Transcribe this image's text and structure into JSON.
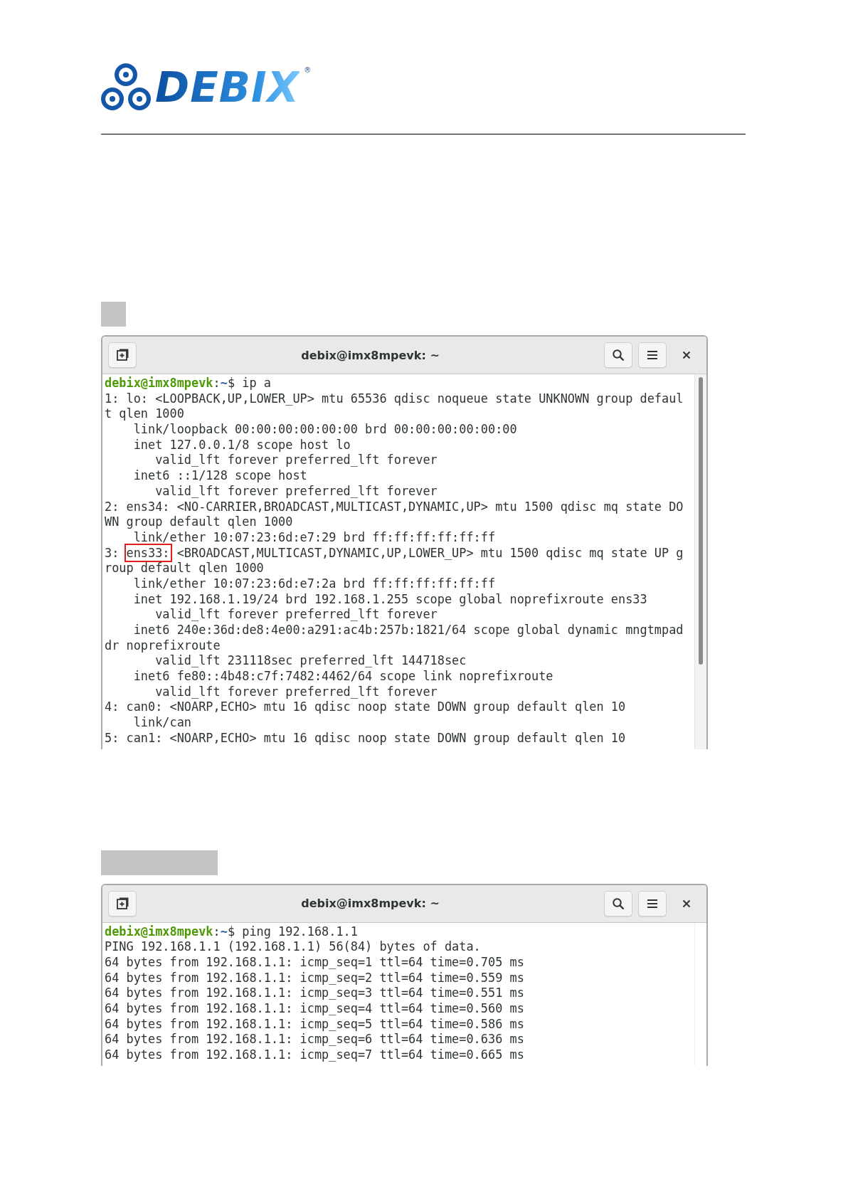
{
  "logo": {
    "text": "DEBIX",
    "mark": "®"
  },
  "sections": [
    {
      "label": {
        "kind": "square"
      },
      "terminal": {
        "title": "debix@imx8mpevk: ~",
        "scrollbar": true,
        "lines": [
          {
            "kind": "prompt",
            "user": "debix@imx8mpevk",
            "sep": ":",
            "path": "~",
            "command": "$ ip a"
          },
          {
            "kind": "plain",
            "text": "1: lo: <LOOPBACK,UP,LOWER_UP> mtu 65536 qdisc noqueue state UNKNOWN group defaul"
          },
          {
            "kind": "plain",
            "text": "t qlen 1000"
          },
          {
            "kind": "plain",
            "text": "    link/loopback 00:00:00:00:00:00 brd 00:00:00:00:00:00"
          },
          {
            "kind": "plain",
            "text": "    inet 127.0.0.1/8 scope host lo"
          },
          {
            "kind": "plain",
            "text": "       valid_lft forever preferred_lft forever"
          },
          {
            "kind": "plain",
            "text": "    inet6 ::1/128 scope host"
          },
          {
            "kind": "plain",
            "text": "       valid_lft forever preferred_lft forever"
          },
          {
            "kind": "plain",
            "text": "2: ens34: <NO-CARRIER,BROADCAST,MULTICAST,DYNAMIC,UP> mtu 1500 qdisc mq state DO"
          },
          {
            "kind": "plain",
            "text": "WN group default qlen 1000"
          },
          {
            "kind": "plain",
            "text": "    link/ether 10:07:23:6d:e7:29 brd ff:ff:ff:ff:ff:ff"
          },
          {
            "kind": "marked",
            "before": "3: ",
            "marked": "ens33:",
            "after": " <BROADCAST,MULTICAST,DYNAMIC,UP,LOWER_UP> mtu 1500 qdisc mq state UP g"
          },
          {
            "kind": "plain",
            "text": "roup default qlen 1000"
          },
          {
            "kind": "plain",
            "text": "    link/ether 10:07:23:6d:e7:2a brd ff:ff:ff:ff:ff:ff"
          },
          {
            "kind": "plain",
            "text": "    inet 192.168.1.19/24 brd 192.168.1.255 scope global noprefixroute ens33"
          },
          {
            "kind": "plain",
            "text": "       valid_lft forever preferred_lft forever"
          },
          {
            "kind": "plain",
            "text": "    inet6 240e:36d:de8:4e00:a291:ac4b:257b:1821/64 scope global dynamic mngtmpad"
          },
          {
            "kind": "plain",
            "text": "dr noprefixroute"
          },
          {
            "kind": "plain",
            "text": "       valid_lft 231118sec preferred_lft 144718sec"
          },
          {
            "kind": "plain",
            "text": "    inet6 fe80::4b48:c7f:7482:4462/64 scope link noprefixroute"
          },
          {
            "kind": "plain",
            "text": "       valid_lft forever preferred_lft forever"
          },
          {
            "kind": "plain",
            "text": "4: can0: <NOARP,ECHO> mtu 16 qdisc noop state DOWN group default qlen 10"
          },
          {
            "kind": "plain",
            "text": "    link/can"
          },
          {
            "kind": "plain",
            "text": "5: can1: <NOARP,ECHO> mtu 16 qdisc noop state DOWN group default qlen 10"
          }
        ]
      }
    },
    {
      "label": {
        "kind": "bar"
      },
      "terminal": {
        "title": "debix@imx8mpevk: ~",
        "scrollbar": false,
        "lines": [
          {
            "kind": "prompt",
            "user": "debix@imx8mpevk",
            "sep": ":",
            "path": "~",
            "command": "$ ping 192.168.1.1"
          },
          {
            "kind": "plain",
            "text": "PING 192.168.1.1 (192.168.1.1) 56(84) bytes of data."
          },
          {
            "kind": "plain",
            "text": "64 bytes from 192.168.1.1: icmp_seq=1 ttl=64 time=0.705 ms"
          },
          {
            "kind": "plain",
            "text": "64 bytes from 192.168.1.1: icmp_seq=2 ttl=64 time=0.559 ms"
          },
          {
            "kind": "plain",
            "text": "64 bytes from 192.168.1.1: icmp_seq=3 ttl=64 time=0.551 ms"
          },
          {
            "kind": "plain",
            "text": "64 bytes from 192.168.1.1: icmp_seq=4 ttl=64 time=0.560 ms"
          },
          {
            "kind": "plain",
            "text": "64 bytes from 192.168.1.1: icmp_seq=5 ttl=64 time=0.586 ms"
          },
          {
            "kind": "plain",
            "text": "64 bytes from 192.168.1.1: icmp_seq=6 ttl=64 time=0.636 ms"
          },
          {
            "kind": "plain",
            "text": "64 bytes from 192.168.1.1: icmp_seq=7 ttl=64 time=0.665 ms"
          }
        ]
      }
    }
  ]
}
